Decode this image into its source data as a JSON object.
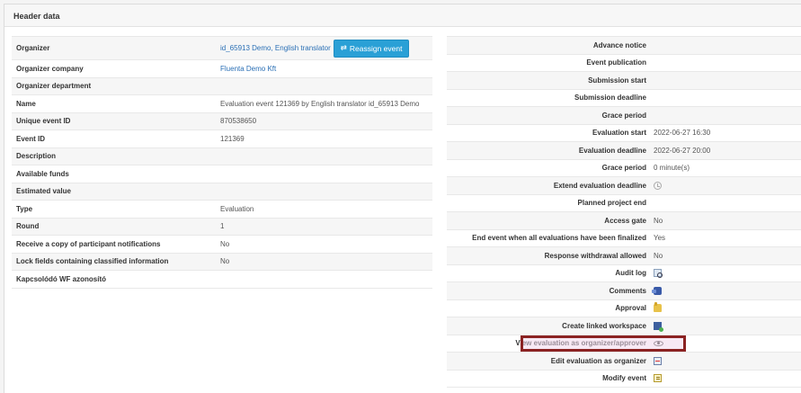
{
  "header": {
    "title": "Header data"
  },
  "left_rows": [
    {
      "key": "Organizer",
      "value": "id_65913 Demo, English translator",
      "link": true,
      "button": "Reassign event"
    },
    {
      "key": "Organizer company",
      "value": "Fluenta Demo Kft",
      "link": true
    },
    {
      "key": "Organizer department",
      "value": ""
    },
    {
      "key": "Name",
      "value": "Evaluation event 121369 by English translator id_65913 Demo"
    },
    {
      "key": "Unique event ID",
      "value": "870538650"
    },
    {
      "key": "Event ID",
      "value": "121369"
    },
    {
      "key": "Description",
      "value": ""
    },
    {
      "key": "Available funds",
      "value": ""
    },
    {
      "key": "Estimated value",
      "value": ""
    },
    {
      "key": "Type",
      "value": "Evaluation"
    },
    {
      "key": "Round",
      "value": "1"
    },
    {
      "key": "Receive a copy of participant notifications",
      "value": "No"
    },
    {
      "key": "Lock fields containing classified information",
      "value": "No"
    },
    {
      "key": "Kapcsolódó WF azonosító",
      "value": ""
    }
  ],
  "right_rows": [
    {
      "key": "Advance notice",
      "value": ""
    },
    {
      "key": "Event publication",
      "value": ""
    },
    {
      "key": "Submission start",
      "value": ""
    },
    {
      "key": "Submission deadline",
      "value": ""
    },
    {
      "key": "Grace period",
      "value": ""
    },
    {
      "key": "Evaluation start",
      "value": "2022-06-27 16:30"
    },
    {
      "key": "Evaluation deadline",
      "value": "2022-06-27 20:00"
    },
    {
      "key": "Grace period",
      "value": "0 minute(s)"
    },
    {
      "key": "Extend evaluation deadline",
      "value": "",
      "icon": "clock-icon"
    },
    {
      "key": "Planned project end",
      "value": ""
    },
    {
      "key": "Access gate",
      "value": "No"
    },
    {
      "key": "End event when all evaluations have been finalized",
      "value": "Yes"
    },
    {
      "key": "Response withdrawal allowed",
      "value": "No"
    },
    {
      "key": "Audit log",
      "value": "",
      "icon": "audit-log-icon"
    },
    {
      "key": "Comments",
      "value": "",
      "icon": "comments-icon"
    },
    {
      "key": "Approval",
      "value": "",
      "icon": "approval-icon"
    },
    {
      "key": "Create linked workspace",
      "value": "",
      "icon": "linked-workspace-icon"
    },
    {
      "key": "View evaluation as organizer/approver",
      "value": "",
      "icon": "eye-icon"
    },
    {
      "key": "Edit evaluation as organizer",
      "value": "",
      "icon": "edit-icon"
    },
    {
      "key": "Modify event",
      "value": "",
      "icon": "modify-icon"
    }
  ],
  "highlight": {
    "color": "#8b2222"
  }
}
